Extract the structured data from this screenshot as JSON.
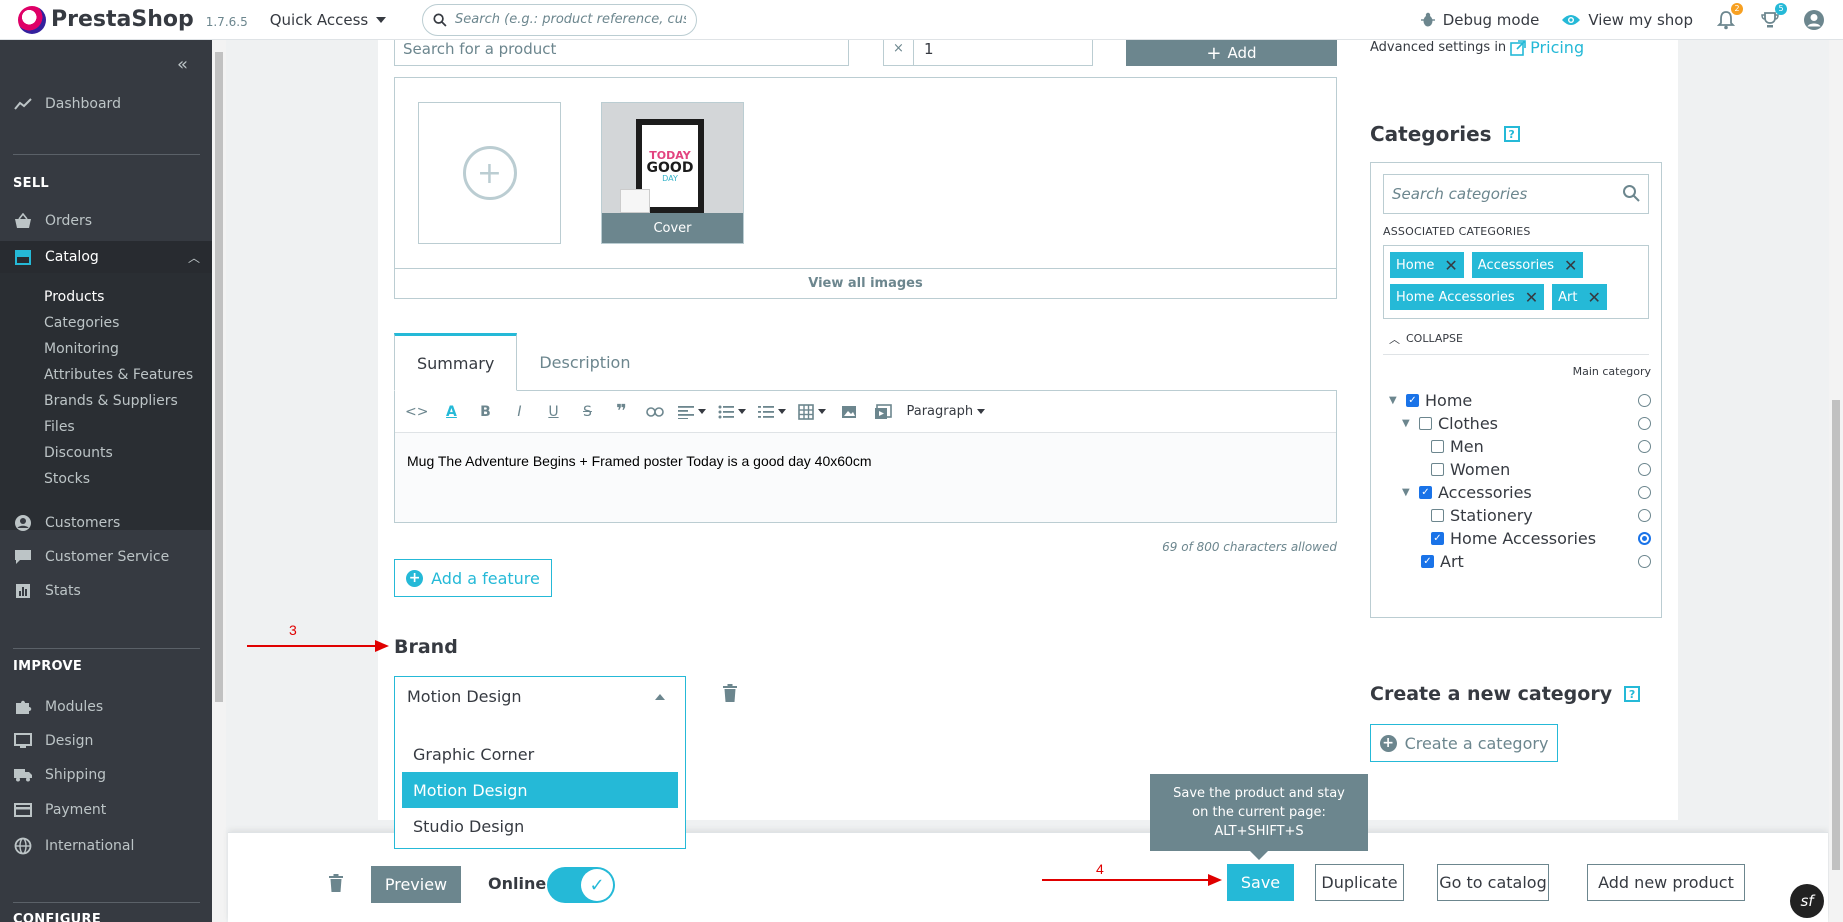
{
  "header": {
    "brand": "PrestaShop",
    "version": "1.7.6.5",
    "quick_access": "Quick Access",
    "search_placeholder": "Search (e.g.: product reference, custome",
    "debug_mode": "Debug mode",
    "view_shop": "View my shop",
    "notif_count": "2",
    "trophy_count": "5"
  },
  "sidebar": {
    "dashboard": "Dashboard",
    "sell_title": "SELL",
    "orders": "Orders",
    "catalog": "Catalog",
    "catalog_sub": [
      "Products",
      "Categories",
      "Monitoring",
      "Attributes & Features",
      "Brands & Suppliers",
      "Files",
      "Discounts",
      "Stocks"
    ],
    "customers": "Customers",
    "customer_service": "Customer Service",
    "stats": "Stats",
    "improve_title": "IMPROVE",
    "modules": "Modules",
    "design": "Design",
    "shipping": "Shipping",
    "payment": "Payment",
    "international": "International",
    "configure_title": "CONFIGURE"
  },
  "product_search": {
    "placeholder": "Search for a product",
    "qty_prefix": "×",
    "qty_value": "1",
    "add_button": "Add"
  },
  "advanced_settings": {
    "label": "Advanced settings in",
    "link": "Pricing"
  },
  "images": {
    "cover_label": "Cover",
    "view_all": "View all images",
    "poster_line1": "TODAY",
    "poster_line2": "GOOD",
    "poster_line3": "DAY"
  },
  "editor": {
    "tabs": [
      "Summary",
      "Description"
    ],
    "paragraph_select": "Paragraph",
    "content": "Mug The Adventure Begins + Framed poster Today is a good day 40x60cm",
    "char_count": "69 of 800 characters allowed"
  },
  "add_feature": "Add a feature",
  "brand": {
    "heading": "Brand",
    "selected": "Motion Design",
    "options": [
      "Graphic Corner",
      "Motion Design",
      "Studio Design"
    ]
  },
  "categories": {
    "title": "Categories",
    "search_placeholder": "Search categories",
    "associated_label": "ASSOCIATED CATEGORIES",
    "tags": [
      "Home",
      "Accessories",
      "Home Accessories",
      "Art"
    ],
    "collapse": "COLLAPSE",
    "main_category_label": "Main category",
    "tree": [
      {
        "label": "Home",
        "checked": true,
        "main": false
      },
      {
        "label": "Clothes",
        "checked": false,
        "main": false
      },
      {
        "label": "Men",
        "checked": false,
        "main": false
      },
      {
        "label": "Women",
        "checked": false,
        "main": false
      },
      {
        "label": "Accessories",
        "checked": true,
        "main": false
      },
      {
        "label": "Stationery",
        "checked": false,
        "main": false
      },
      {
        "label": "Home Accessories",
        "checked": true,
        "main": true
      },
      {
        "label": "Art",
        "checked": true,
        "main": false
      }
    ]
  },
  "new_category": {
    "title": "Create a new category",
    "button": "Create a category"
  },
  "footer": {
    "preview": "Preview",
    "online": "Online",
    "save": "Save",
    "duplicate": "Duplicate",
    "go_to_catalog": "Go to catalog",
    "add_new_product": "Add new product",
    "tooltip_line1": "Save the product and stay",
    "tooltip_line2": "on the current page:",
    "tooltip_line3": "ALT+SHIFT+S"
  },
  "annotations": {
    "brand_marker": "3",
    "save_marker": "4"
  },
  "symfony_badge": "sf",
  "colors": {
    "accent": "#25b9d7",
    "sidebar_bg": "#363a41",
    "annotation": "#e00000",
    "button_grey": "#6c868e"
  }
}
